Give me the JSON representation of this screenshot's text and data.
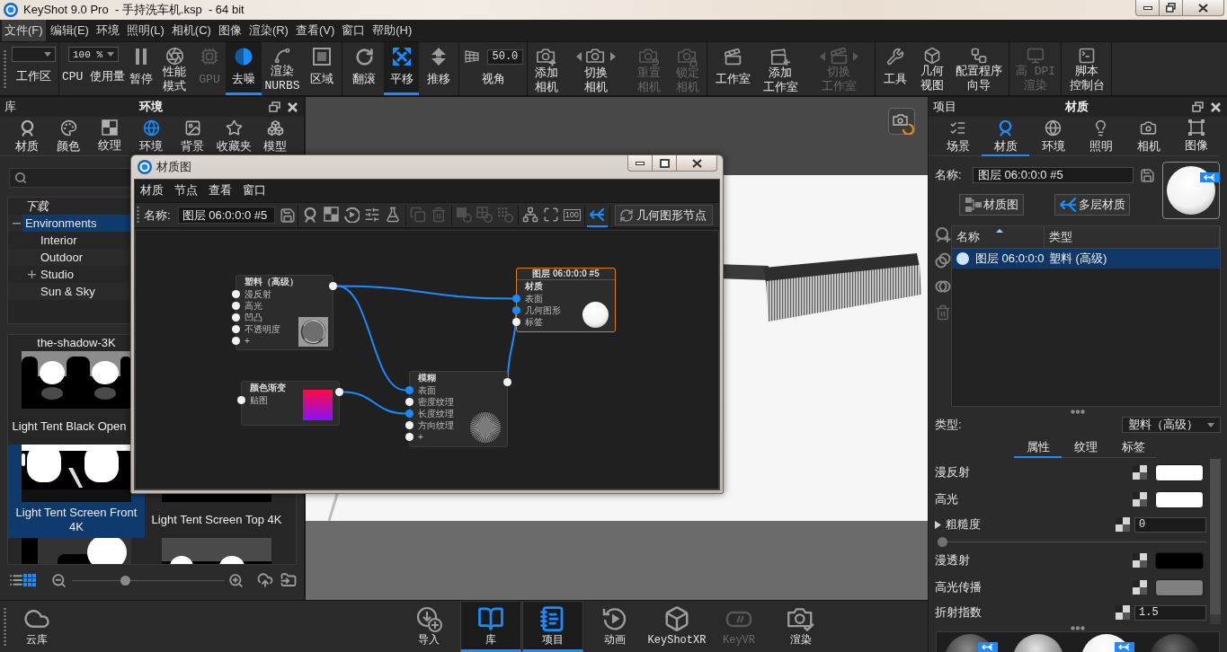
{
  "window": {
    "title": "KeyShot 9.0 Pro  - 手持洗车机.ksp  - 64 bit"
  },
  "menu": [
    {
      "label": "文件(F)",
      "selected": true
    },
    {
      "label": "编辑(E)",
      "selected": false
    },
    {
      "label": "环境",
      "selected": false
    },
    {
      "label": "照明(L)",
      "selected": false
    },
    {
      "label": "相机(C)",
      "selected": false
    },
    {
      "label": "图像",
      "selected": false
    },
    {
      "label": "渲染(R)",
      "selected": false
    },
    {
      "label": "查看(V)",
      "selected": false
    },
    {
      "label": "窗口",
      "selected": false
    },
    {
      "label": "帮助(H)",
      "selected": false
    }
  ],
  "toolbar": [
    [
      {
        "kind": "dropdown",
        "label": "工作区",
        "on": false,
        "disabled": false
      }
    ],
    [
      {
        "kind": "dropdown",
        "value": "100 %",
        "label": "CPU 使用量",
        "on": false,
        "disabled": false
      },
      {
        "kind": "button",
        "label": "暂停",
        "on": false,
        "disabled": false
      },
      {
        "kind": "button",
        "lines": [
          "性能",
          "模式"
        ],
        "on": false,
        "disabled": false
      },
      {
        "kind": "button",
        "label": "GPU",
        "on": false,
        "disabled": true
      },
      {
        "kind": "button",
        "label": "去噪",
        "on": true,
        "disabled": false
      },
      {
        "kind": "button",
        "lines": [
          "渲染",
          "NURBS"
        ],
        "on": false,
        "disabled": false
      },
      {
        "kind": "button",
        "label": "区域",
        "on": false,
        "disabled": false
      }
    ],
    [
      {
        "kind": "button",
        "label": "翻滚",
        "on": false,
        "disabled": false
      },
      {
        "kind": "button",
        "label": "平移",
        "on": true,
        "disabled": false
      },
      {
        "kind": "button",
        "label": "推移",
        "on": false,
        "disabled": false
      }
    ],
    [
      {
        "kind": "field",
        "value": "50.0",
        "label": "视角",
        "on": false,
        "disabled": false
      }
    ],
    [
      {
        "kind": "button",
        "lines": [
          "添加",
          "相机"
        ],
        "on": false,
        "disabled": false
      },
      {
        "kind": "switch",
        "lines": [
          "切换",
          "相机"
        ],
        "on": false,
        "disabled": false
      },
      {
        "kind": "button",
        "lines": [
          "重置",
          "相机"
        ],
        "on": false,
        "disabled": true
      },
      {
        "kind": "button",
        "lines": [
          "锁定",
          "相机"
        ],
        "on": false,
        "disabled": true
      }
    ],
    [
      {
        "kind": "button",
        "label": "工作室",
        "on": false,
        "disabled": false
      },
      {
        "kind": "button",
        "lines": [
          "添加",
          "工作室"
        ],
        "on": false,
        "disabled": false
      },
      {
        "kind": "switch",
        "lines": [
          "切换",
          "工作室"
        ],
        "on": false,
        "disabled": true
      }
    ],
    [
      {
        "kind": "button",
        "label": "工具",
        "on": false,
        "disabled": false
      },
      {
        "kind": "button",
        "lines": [
          "几何",
          "视图"
        ],
        "on": false,
        "disabled": false
      },
      {
        "kind": "button",
        "lines": [
          "配置程序",
          "向导"
        ],
        "on": false,
        "disabled": false
      }
    ],
    [
      {
        "kind": "button",
        "lines": [
          "高 DPI",
          "渲染"
        ],
        "on": false,
        "disabled": true
      }
    ],
    [
      {
        "kind": "button",
        "lines": [
          "脚本",
          "控制台"
        ],
        "on": false,
        "disabled": false
      }
    ]
  ],
  "library": {
    "title": "库",
    "heading": "环境",
    "tabs": [
      {
        "label": "材质",
        "selected": false
      },
      {
        "label": "颜色",
        "selected": false
      },
      {
        "label": "纹理",
        "selected": false
      },
      {
        "label": "环境",
        "selected": true
      },
      {
        "label": "背景",
        "selected": false
      },
      {
        "label": "收藏夹",
        "selected": false
      },
      {
        "label": "模型",
        "selected": false
      }
    ],
    "tree": [
      {
        "label": "下载",
        "kind": "downloads",
        "selected": false
      },
      {
        "label": "Environments",
        "kind": "folder",
        "selected": true,
        "expanded": true,
        "children": [
          {
            "label": "Interior",
            "kind": "folder",
            "selected": false
          },
          {
            "label": "Outdoor",
            "kind": "folder",
            "selected": false
          },
          {
            "label": "Studio",
            "kind": "folder",
            "selected": false,
            "expanded": false
          },
          {
            "label": "Sun & Sky",
            "kind": "folder",
            "selected": false
          }
        ]
      }
    ],
    "items": [
      {
        "label": "the-shadow-3K",
        "selected": false
      },
      {
        "label": "Light Tent Black Open",
        "selected": false
      },
      {
        "label": "Light Tent Screen Front 4K",
        "selected": true
      },
      {
        "label": "Light Tent Screen Top 4K",
        "selected": false
      },
      {
        "selected": false
      },
      {
        "selected": false
      }
    ],
    "view_modes": [
      {
        "selected": false
      },
      {
        "selected": true
      }
    ],
    "zoom": {
      "level": 0.34
    }
  },
  "graph": {
    "title": "材质图",
    "menu": [
      "材质",
      "节点",
      "查看",
      "窗口"
    ],
    "name_label": "名称:",
    "name": "图层 06:0:0:0 #5",
    "tools": [
      {
        "disabled": false,
        "on": false
      },
      {
        "disabled": false,
        "on": false
      },
      {
        "disabled": false,
        "on": false
      },
      {
        "disabled": false,
        "on": false
      },
      {
        "disabled": false,
        "on": false
      },
      {
        "disabled": true,
        "on": false
      },
      {
        "disabled": true,
        "on": false
      },
      {
        "disabled": true,
        "on": false
      },
      {
        "disabled": true,
        "on": false
      },
      {
        "disabled": true,
        "on": false
      },
      {
        "disabled": false,
        "on": false
      },
      {
        "disabled": false,
        "on": false
      },
      {
        "label": "100",
        "disabled": false,
        "on": false
      },
      {
        "disabled": false,
        "on": true
      }
    ],
    "geometry_button": "几何图形节点",
    "nodes": [
      {
        "kind": "material",
        "title": "塑料（高级）",
        "selected": false,
        "inputs": [
          {
            "label": "漫反射",
            "connected": false
          },
          {
            "label": "高光",
            "connected": false
          },
          {
            "label": "凹凸",
            "connected": false
          },
          {
            "label": "不透明度",
            "connected": false
          },
          {
            "label": "+",
            "connected": false
          }
        ]
      },
      {
        "kind": "texture",
        "title": "颜色渐变",
        "selected": false,
        "inputs": [
          {
            "label": "贴图",
            "connected": false
          }
        ]
      },
      {
        "kind": "geometry",
        "title": "模糊",
        "selected": false,
        "inputs": [
          {
            "label": "表面",
            "connected": true
          },
          {
            "label": "密度纹理",
            "connected": false
          },
          {
            "label": "长度纹理",
            "connected": true
          },
          {
            "label": "方向纹理",
            "connected": false
          },
          {
            "label": "+",
            "connected": false
          }
        ]
      },
      {
        "kind": "output",
        "title": "图层 06:0:0:0 #5",
        "subtitle": "材质",
        "selected": true,
        "inputs": [
          {
            "label": "表面",
            "connected": true
          },
          {
            "label": "几何图形",
            "connected": true
          },
          {
            "label": "标签",
            "connected": false
          }
        ]
      }
    ]
  },
  "project": {
    "title": "项目",
    "heading": "材质",
    "tabs": [
      {
        "label": "场景",
        "selected": false
      },
      {
        "label": "材质",
        "selected": true
      },
      {
        "label": "环境",
        "selected": false
      },
      {
        "label": "照明",
        "selected": false
      },
      {
        "label": "相机",
        "selected": false
      },
      {
        "label": "图像",
        "selected": false
      }
    ],
    "name_label": "名称:",
    "name": "图层 06:0:0:0 #5",
    "preview": {
      "multi_material": true
    },
    "buttons": [
      "材质图",
      "多层材质"
    ],
    "table": {
      "columns": [
        "名称",
        "类型"
      ],
      "rows": [
        {
          "name": "图层 06:0:0:0",
          "type": "塑料 (高级)",
          "selected": true
        }
      ]
    },
    "type_label": "类型:",
    "type": "塑料（高级）",
    "subtabs": [
      {
        "label": "属性",
        "selected": true
      },
      {
        "label": "纹理",
        "selected": false
      },
      {
        "label": "标签",
        "selected": false
      }
    ],
    "properties": [
      {
        "kind": "color",
        "label": "漫反射",
        "color": "#ffffff"
      },
      {
        "kind": "color",
        "label": "高光",
        "color": "#ffffff"
      },
      {
        "kind": "number",
        "label": "粗糙度",
        "value": "0",
        "expanded": false,
        "level": 0
      },
      {
        "kind": "color",
        "label": "漫透射",
        "color": "#000000"
      },
      {
        "kind": "color",
        "label": "高光传播",
        "color": "#808080"
      },
      {
        "kind": "number",
        "label": "折射指数",
        "value": "1.5"
      }
    ],
    "materials": [
      {
        "multi_material": true
      },
      {
        "multi_material": false
      },
      {
        "multi_material": true
      },
      {
        "multi_material": false
      }
    ]
  },
  "dock": {
    "cloud": {
      "label": "云库"
    },
    "items": [
      {
        "label": "导入",
        "on": false,
        "disabled": false
      },
      {
        "label": "库",
        "on": true,
        "disabled": false
      },
      {
        "label": "项目",
        "on": true,
        "disabled": false
      },
      {
        "label": "动画",
        "on": false,
        "disabled": false
      },
      {
        "label": "KeyShotXR",
        "on": false,
        "disabled": false
      },
      {
        "label": "KeyVR",
        "on": false,
        "disabled": true
      },
      {
        "label": "渲染",
        "on": false,
        "disabled": false
      }
    ]
  }
}
